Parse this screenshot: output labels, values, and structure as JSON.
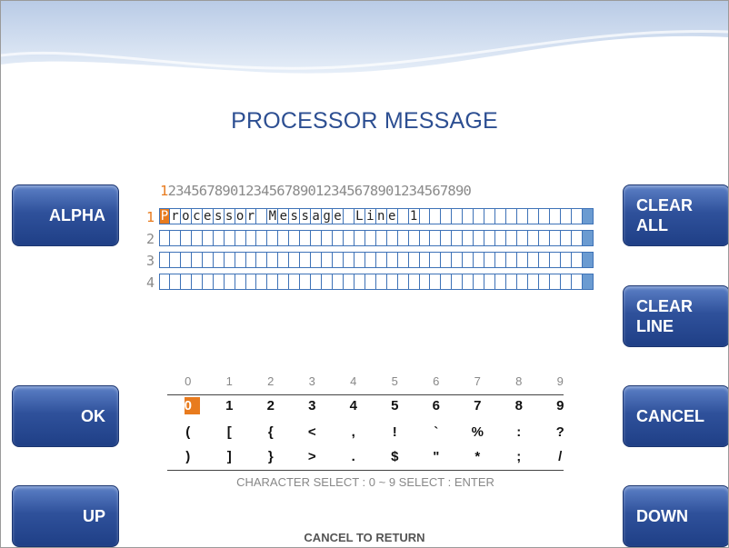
{
  "title": "PROCESSOR MESSAGE",
  "buttons": {
    "alpha": "ALPHA",
    "ok": "OK",
    "up": "UP",
    "clear_all": "CLEAR\nALL",
    "clear_line": "CLEAR\nLINE",
    "cancel": "CANCEL",
    "down": "DOWN"
  },
  "editor": {
    "ruler_first": "1",
    "ruler_rest": "234567890123456789012345678901234567890",
    "row_numbers": [
      "1",
      "2",
      "3",
      "4"
    ],
    "lines": [
      "Processor Message Line 1",
      "",
      "",
      ""
    ],
    "cursor": {
      "row": 1,
      "col": 1
    },
    "columns": 40
  },
  "charset": {
    "column_numbers": [
      "0",
      "1",
      "2",
      "3",
      "4",
      "5",
      "6",
      "7",
      "8",
      "9"
    ],
    "rows": [
      [
        "0",
        "1",
        "2",
        "3",
        "4",
        "5",
        "6",
        "7",
        "8",
        "9"
      ],
      [
        "(",
        "[",
        "{",
        "<",
        ",",
        "!",
        "`",
        "%",
        ":",
        "?"
      ],
      [
        ")",
        "]",
        "}",
        ">",
        ".",
        "$",
        "\"",
        "*",
        ";",
        "/"
      ]
    ],
    "selected": "0"
  },
  "hint": "CHARACTER SELECT : 0 ~ 9  SELECT : ENTER",
  "footer": "CANCEL TO RETURN",
  "colors": {
    "accent": "#e87b1e",
    "button": "#2f519b",
    "grid": "#3e72b7",
    "title": "#2d4f92"
  }
}
